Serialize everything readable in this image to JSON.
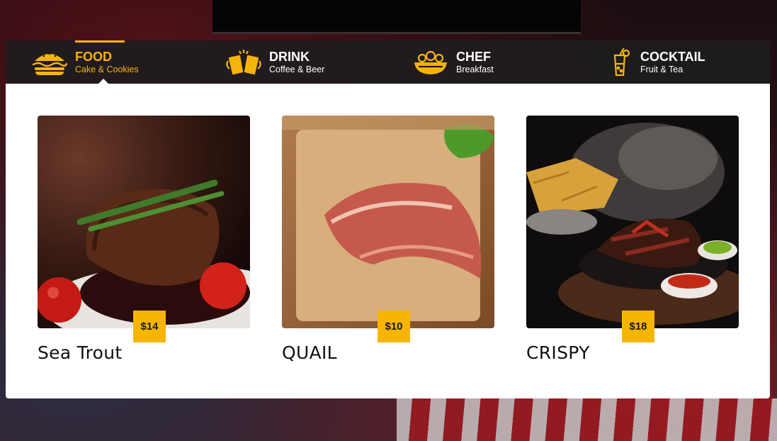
{
  "tabs": [
    {
      "title": "FOOD",
      "subtitle": "Cake & Cookies",
      "icon": "burger-icon",
      "active": true
    },
    {
      "title": "DRINK",
      "subtitle": "Coffee & Beer",
      "icon": "beer-mugs-icon",
      "active": false
    },
    {
      "title": "CHEF",
      "subtitle": "Breakfast",
      "icon": "salad-bowl-icon",
      "active": false
    },
    {
      "title": "COCKTAIL",
      "subtitle": "Fruit & Tea",
      "icon": "cocktail-glass-icon",
      "active": false
    }
  ],
  "menu_items": [
    {
      "name": "Sea Trout",
      "price": "$14"
    },
    {
      "name": "QUAIL",
      "price": "$10"
    },
    {
      "name": "CRISPY",
      "price": "$18"
    }
  ],
  "colors": {
    "accent": "#f5b40c",
    "tab_bar": "#1e1c1e",
    "panel": "#ffffff"
  }
}
